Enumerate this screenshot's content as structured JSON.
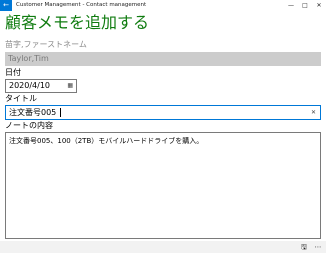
{
  "window": {
    "title": "Customer Management - Contact management",
    "back_icon": "arrow-left-icon",
    "minimize": "—",
    "maximize": "□",
    "close": "✕"
  },
  "page": {
    "title": "顧客メモを追加する"
  },
  "form": {
    "name_label": "苗字,ファーストネーム",
    "name_value": "Taylor,Tim",
    "date_label": "日付",
    "date_value": "2020/4/10",
    "title_label": "タイトル",
    "title_value": "注文番号005",
    "notes_label": "ノートの内容",
    "notes_value": "注文番号005、100（2TB）モバイルハードドライブを購入。"
  },
  "icons": {
    "calendar": "▦",
    "clear": "✕",
    "save": "🖫",
    "more": "⋯"
  }
}
